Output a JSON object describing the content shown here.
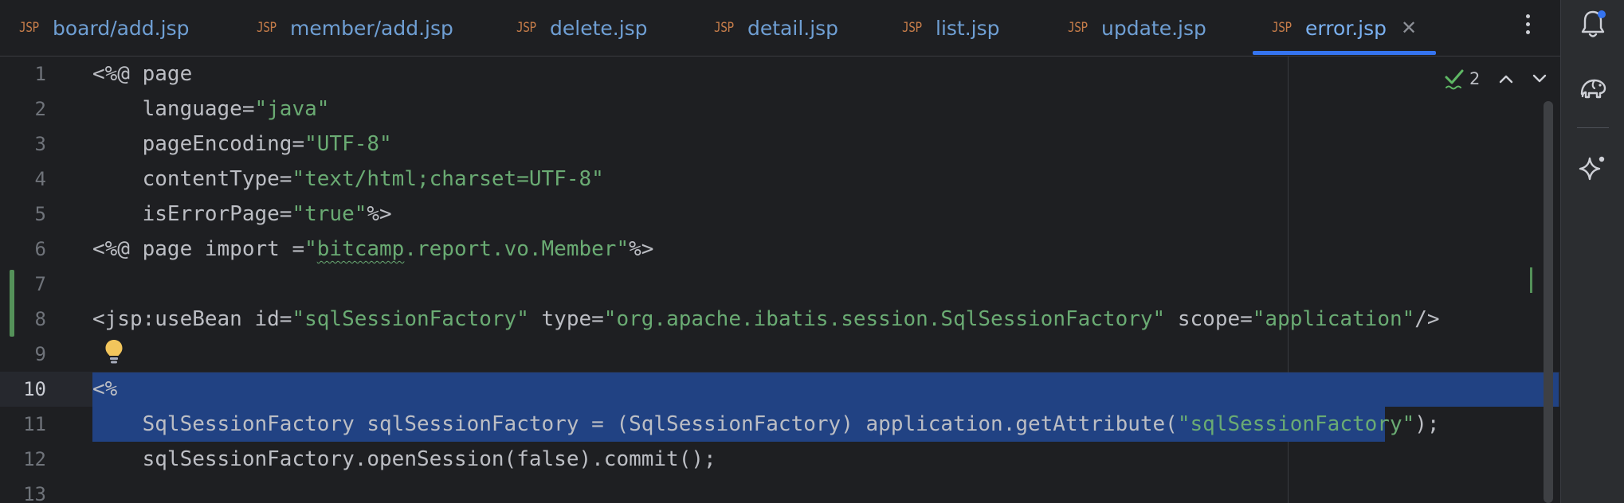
{
  "tabs": [
    {
      "type": "JSP",
      "name": "board/add.jsp",
      "active": false
    },
    {
      "type": "JSP",
      "name": "member/add.jsp",
      "active": false
    },
    {
      "type": "JSP",
      "name": "delete.jsp",
      "active": false
    },
    {
      "type": "JSP",
      "name": "detail.jsp",
      "active": false
    },
    {
      "type": "JSP",
      "name": "list.jsp",
      "active": false
    },
    {
      "type": "JSP",
      "name": "update.jsp",
      "active": false
    },
    {
      "type": "JSP",
      "name": "error.jsp",
      "active": true
    }
  ],
  "inspection": {
    "count": "2"
  },
  "line_numbers": [
    "1",
    "2",
    "3",
    "4",
    "5",
    "6",
    "7",
    "8",
    "9",
    "10",
    "11",
    "12",
    "13"
  ],
  "current_line": "10",
  "code": {
    "l1": {
      "a": "<%@ page"
    },
    "l2": {
      "a": "    language=",
      "b": "\"java\""
    },
    "l3": {
      "a": "    pageEncoding=",
      "b": "\"UTF-8\""
    },
    "l4": {
      "a": "    contentType=",
      "b": "\"text/html;charset=UTF-8\""
    },
    "l5": {
      "a": "    isErrorPage=",
      "b": "\"true\"",
      "c": "%>"
    },
    "l6": {
      "a": "<%@ page import =",
      "b": "\"",
      "c": "bitcamp",
      "d": ".report.vo.Member\"",
      "e": "%>"
    },
    "l8": {
      "a": "<jsp:useBean id=",
      "b": "\"sqlSessionFactory\"",
      "c": " type=",
      "d": "\"org.apache.ibatis.session.SqlSessionFactory\"",
      "e": " scope=",
      "f": "\"application\"",
      "g": "/>"
    },
    "l10": {
      "a": "<%"
    },
    "l11": {
      "a": "    SqlSessionFactory sqlSessionFactory = (SqlSessionFactory) application.getAttribute(",
      "b": "\"sqlSessionFactory\"",
      "c": ");"
    },
    "l12": {
      "a": "    sqlSessionFactory.openSession(false).commit();"
    }
  },
  "colors": {
    "background": "#1e1f22",
    "string": "#6aab73",
    "selection": "#214283",
    "accent": "#3574f0",
    "file_type": "#c77d4a"
  },
  "icons": {
    "tab_close": "close-icon",
    "more": "more-vertical-icon",
    "notifications": "bell-icon",
    "tool_2": "elephant-icon",
    "ai_assistant": "sparkle-icon",
    "inspection": "check-icon",
    "bulb": "lightbulb-icon"
  }
}
